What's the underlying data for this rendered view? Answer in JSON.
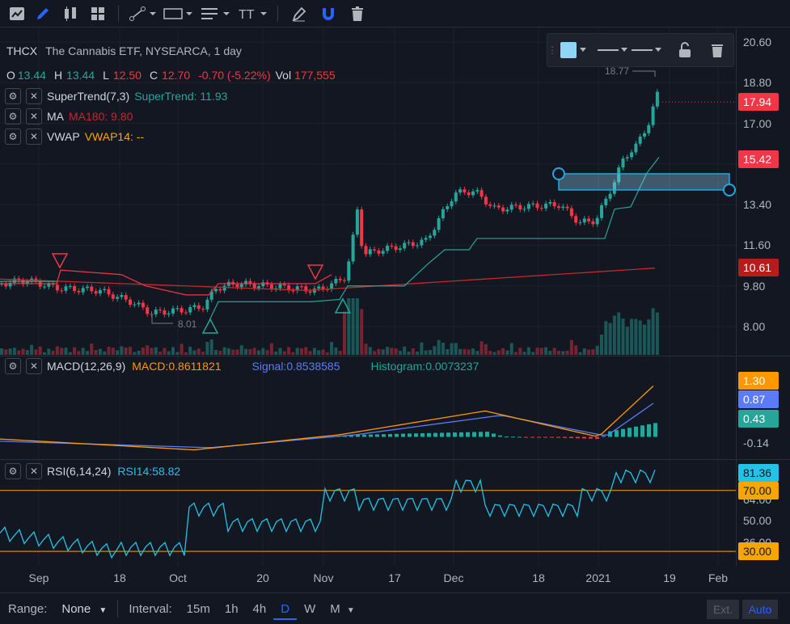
{
  "symbol": {
    "ticker": "THCX",
    "name": "The Cannabis ETF, NYSEARCA, 1 day"
  },
  "ohlc": {
    "o_label": "O",
    "o": "13.44",
    "h_label": "H",
    "h": "13.44",
    "l_label": "L",
    "l": "12.50",
    "c_label": "C",
    "c": "12.70",
    "change": "-0.70 (-5.22%)",
    "vol_label": "Vol",
    "vol": "177,555"
  },
  "indicators": [
    {
      "name": "SuperTrend(7,3)",
      "value": "SuperTrend: 11.93",
      "color": "#26a69a"
    },
    {
      "name": "MA",
      "value": "MA180: 9.80",
      "color": "#c62828"
    },
    {
      "name": "VWAP",
      "value": "VWAP14: --",
      "color": "#f7a600"
    }
  ],
  "price_axis": {
    "ticks": [
      "20.60",
      "18.80",
      "17.00",
      "15.20",
      "13.40",
      "11.60",
      "9.80",
      "8.00"
    ],
    "tags": [
      {
        "text": "17.94",
        "color": "#f23645"
      },
      {
        "text": "15.42",
        "color": "#f23645"
      },
      {
        "text": "10.61",
        "color": "#b71c1c"
      }
    ]
  },
  "annotations": {
    "high": "18.77",
    "low": "8.01"
  },
  "macd": {
    "name": "MACD(12,26,9)",
    "macd": "MACD:0.8611821",
    "signal": "Signal:0.8538585",
    "histogram": "Histogram:0.0073237",
    "ticks": [
      "-0.14"
    ],
    "tags": [
      {
        "text": "1.30",
        "color": "#ff9800"
      },
      {
        "text": "0.87",
        "color": "#5b7cf7"
      },
      {
        "text": "0.43",
        "color": "#26a69a"
      }
    ]
  },
  "rsi": {
    "name": "RSI(6,14,24)",
    "value": "RSI14:58.82",
    "ticks": [
      "64.00",
      "50.00",
      "36.00"
    ],
    "tags": [
      {
        "text": "81.36",
        "color": "#22c3e6"
      },
      {
        "text": "70.00",
        "color": "#f7a600"
      },
      {
        "text": "30.00",
        "color": "#f7a600"
      }
    ]
  },
  "x_axis": [
    "Sep",
    "18",
    "Oct",
    "20",
    "Nov",
    "17",
    "Dec",
    "18",
    "2021",
    "19",
    "Feb"
  ],
  "bottom": {
    "range_label": "Range:",
    "range_value": "None",
    "interval_label": "Interval:",
    "intervals": [
      "15m",
      "1h",
      "4h",
      "D",
      "W",
      "M"
    ],
    "active": "D",
    "ext": "Ext.",
    "auto": "Auto"
  },
  "colors": {
    "bg": "#131722",
    "up": "#26a69a",
    "down": "#f23645",
    "accent": "#2962ff",
    "rect": "#22a7e0"
  },
  "icons": [
    "chart-icon",
    "pencil-icon",
    "candles-icon",
    "grid-icon",
    "trendline-icon",
    "rectangle-icon",
    "lines-icon",
    "text-icon",
    "highlighter-icon",
    "magnet-icon",
    "trash-icon"
  ]
}
